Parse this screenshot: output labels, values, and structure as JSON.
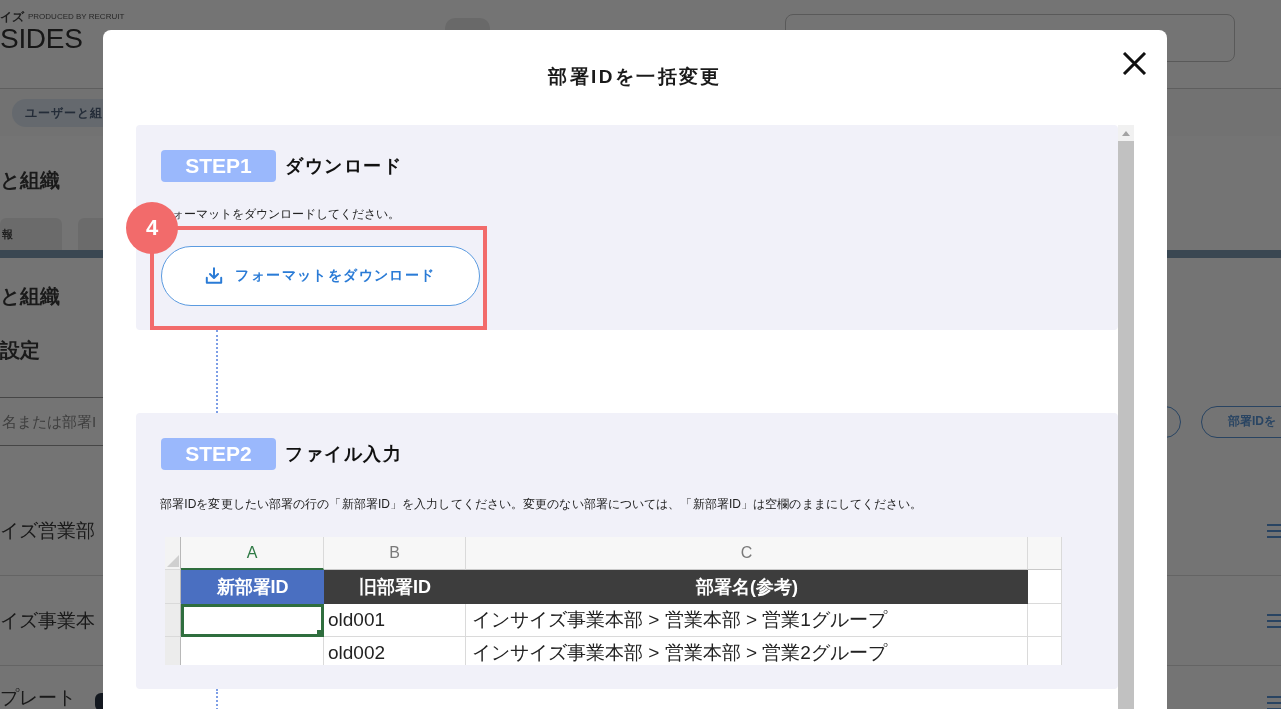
{
  "page": {
    "logo": {
      "kana": "イズ",
      "credit": "PRODUCED BY RECRUIT",
      "wordmark": "SIDES"
    },
    "breadcrumb": "ユーザーと組",
    "heading": "と組織",
    "tabs": [
      "報"
    ],
    "section_heading": "と組織",
    "subheading": "設定",
    "search": {
      "placeholder": "名または部署I"
    },
    "action_button": "部署IDを",
    "rows": [
      "イズ営業部",
      "イズ事業本",
      "プレート"
    ]
  },
  "modal": {
    "title": "部署IDを一括変更",
    "steps": [
      {
        "kind": "download",
        "badge": "STEP1",
        "title": "ダウンロード",
        "description": "ォーマットをダウンロードしてください。",
        "button": "フォーマットをダウンロード",
        "annotation": "4"
      },
      {
        "kind": "spreadsheet",
        "badge": "STEP2",
        "title": "ファイル入力",
        "description": "部署IDを変更したい部署の行の「新部署ID」を入力してください。変更のない部署については、「新部署ID」は空欄のままにしてください。",
        "spreadsheet": {
          "columns": [
            {
              "letter": "A",
              "selected": true
            },
            {
              "letter": "B",
              "selected": false
            },
            {
              "letter": "C",
              "selected": false
            }
          ],
          "header": [
            {
              "label": "新部署ID",
              "color": "#4a6fc1"
            },
            {
              "label": "旧部署ID",
              "color": "#3d3d3d"
            },
            {
              "label": "部署名(参考)",
              "color": "#3d3d3d"
            }
          ],
          "rows": [
            {
              "old_id": "old001",
              "name": "インサイズ事業本部 > 営業本部 > 営業1グループ",
              "selected": true
            },
            {
              "old_id": "old002",
              "name": "インサイズ事業本部 > 営業本部 > 営業2グループ",
              "selected": false
            }
          ]
        }
      }
    ]
  }
}
